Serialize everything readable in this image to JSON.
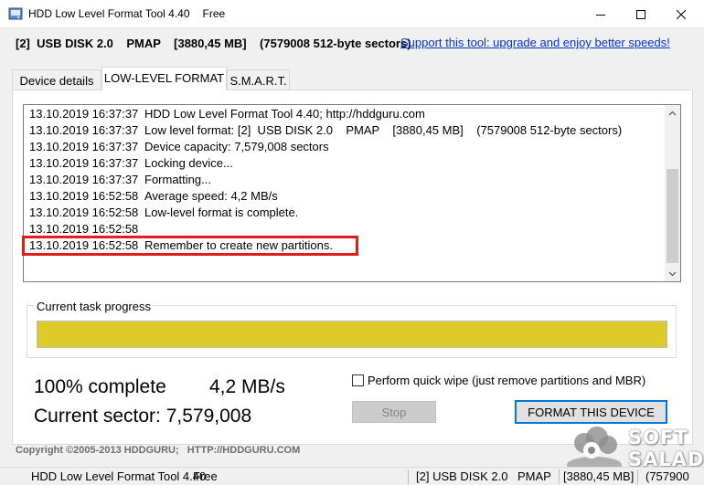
{
  "window": {
    "title": "HDD Low Level Format Tool 4.40",
    "edition": "Free",
    "icons": {
      "app": "app-icon",
      "minimize": "minimize-icon",
      "maximize": "maximize-icon",
      "close": "close-icon"
    }
  },
  "infobar": {
    "disk_info": "[2]  USB DISK 2.0    PMAP    [3880,45 MB]    (7579008 512-byte sectors)",
    "support_link": "Support this tool: upgrade and enjoy better speeds!"
  },
  "tabs": [
    {
      "label": "Device details",
      "active": false
    },
    {
      "label": "LOW-LEVEL FORMAT",
      "active": true
    },
    {
      "label": "S.M.A.R.T.",
      "active": false
    }
  ],
  "log": [
    {
      "timestamp": "13.10.2019 16:37:37",
      "message": "HDD Low Level Format Tool 4.40; http://hddguru.com"
    },
    {
      "timestamp": "13.10.2019 16:37:37",
      "message": "Low level format: [2]  USB DISK 2.0    PMAP    [3880,45 MB]    (7579008 512-byte sectors)"
    },
    {
      "timestamp": "13.10.2019 16:37:37",
      "message": "Device capacity: 7,579,008 sectors"
    },
    {
      "timestamp": "13.10.2019 16:37:37",
      "message": "Locking device..."
    },
    {
      "timestamp": "13.10.2019 16:37:37",
      "message": "Formatting..."
    },
    {
      "timestamp": "13.10.2019 16:52:58",
      "message": "Average speed: 4,2 MB/s"
    },
    {
      "timestamp": "13.10.2019 16:52:58",
      "message": "Low-level format is complete."
    },
    {
      "timestamp": "13.10.2019 16:52:58",
      "message": ""
    },
    {
      "timestamp": "13.10.2019 16:52:58",
      "message": "Remember to create new partitions."
    }
  ],
  "progress": {
    "legend": "Current task progress",
    "percent": 100,
    "fill_color": "#dccb28",
    "complete_text": "100% complete",
    "speed_text": "4,2 MB/s",
    "sector_text": "Current sector: 7,579,008"
  },
  "options": {
    "quick_wipe_label": "Perform quick wipe (just remove partitions and MBR)",
    "quick_wipe_checked": false
  },
  "buttons": {
    "stop": "Stop",
    "format": "FORMAT THIS DEVICE"
  },
  "copyright": "Copyright ©2005-2013 HDDGURU;   HTTP://HDDGURU.COM",
  "watermark": {
    "line1": "SOFT",
    "line2": "SALAD"
  },
  "statusbar": {
    "title": "HDD Low Level Format Tool 4.40",
    "edition": "Free",
    "device": "[2]  USB DISK 2.0",
    "mode": "PMAP",
    "size": "[3880,45 MB]",
    "sectors": "(757900"
  },
  "colors": {
    "accent": "#0078d7",
    "highlight": "#e21b1b",
    "link": "#0033cc"
  }
}
